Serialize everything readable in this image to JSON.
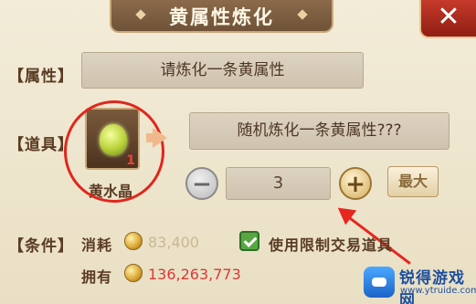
{
  "title": "黄属性炼化",
  "close_label": "✕",
  "attribute_row": {
    "label": "【属性】",
    "value": "请炼化一条黄属性"
  },
  "item_row": {
    "label": "【道具】",
    "item_name": "黄水晶",
    "item_count": "1",
    "result_text": "随机炼化一条黄属性???"
  },
  "quantity": {
    "value": "3",
    "max_label": "最大"
  },
  "condition_row": {
    "label": "【条件】",
    "cost_label": "消耗",
    "cost_value": "83,400",
    "checkbox_label": "使用限制交易道具",
    "checkbox_checked": true,
    "owned_label": "拥有",
    "owned_value": "136,263,773"
  },
  "watermark": {
    "title": "锐得游戏网",
    "url": "www.ytruide.com"
  },
  "colors": {
    "annotation_red": "#e1261c",
    "cost_color": "#c9b98f",
    "owned_color": "#d63b36",
    "accent_gold": "#d9a42f"
  },
  "icons": {
    "gem": "yellow-crystal-icon",
    "coin": "gold-coin-icon",
    "check": "checkbox-checked-icon",
    "minus": "minus-icon",
    "plus": "plus-icon",
    "close": "close-icon"
  }
}
